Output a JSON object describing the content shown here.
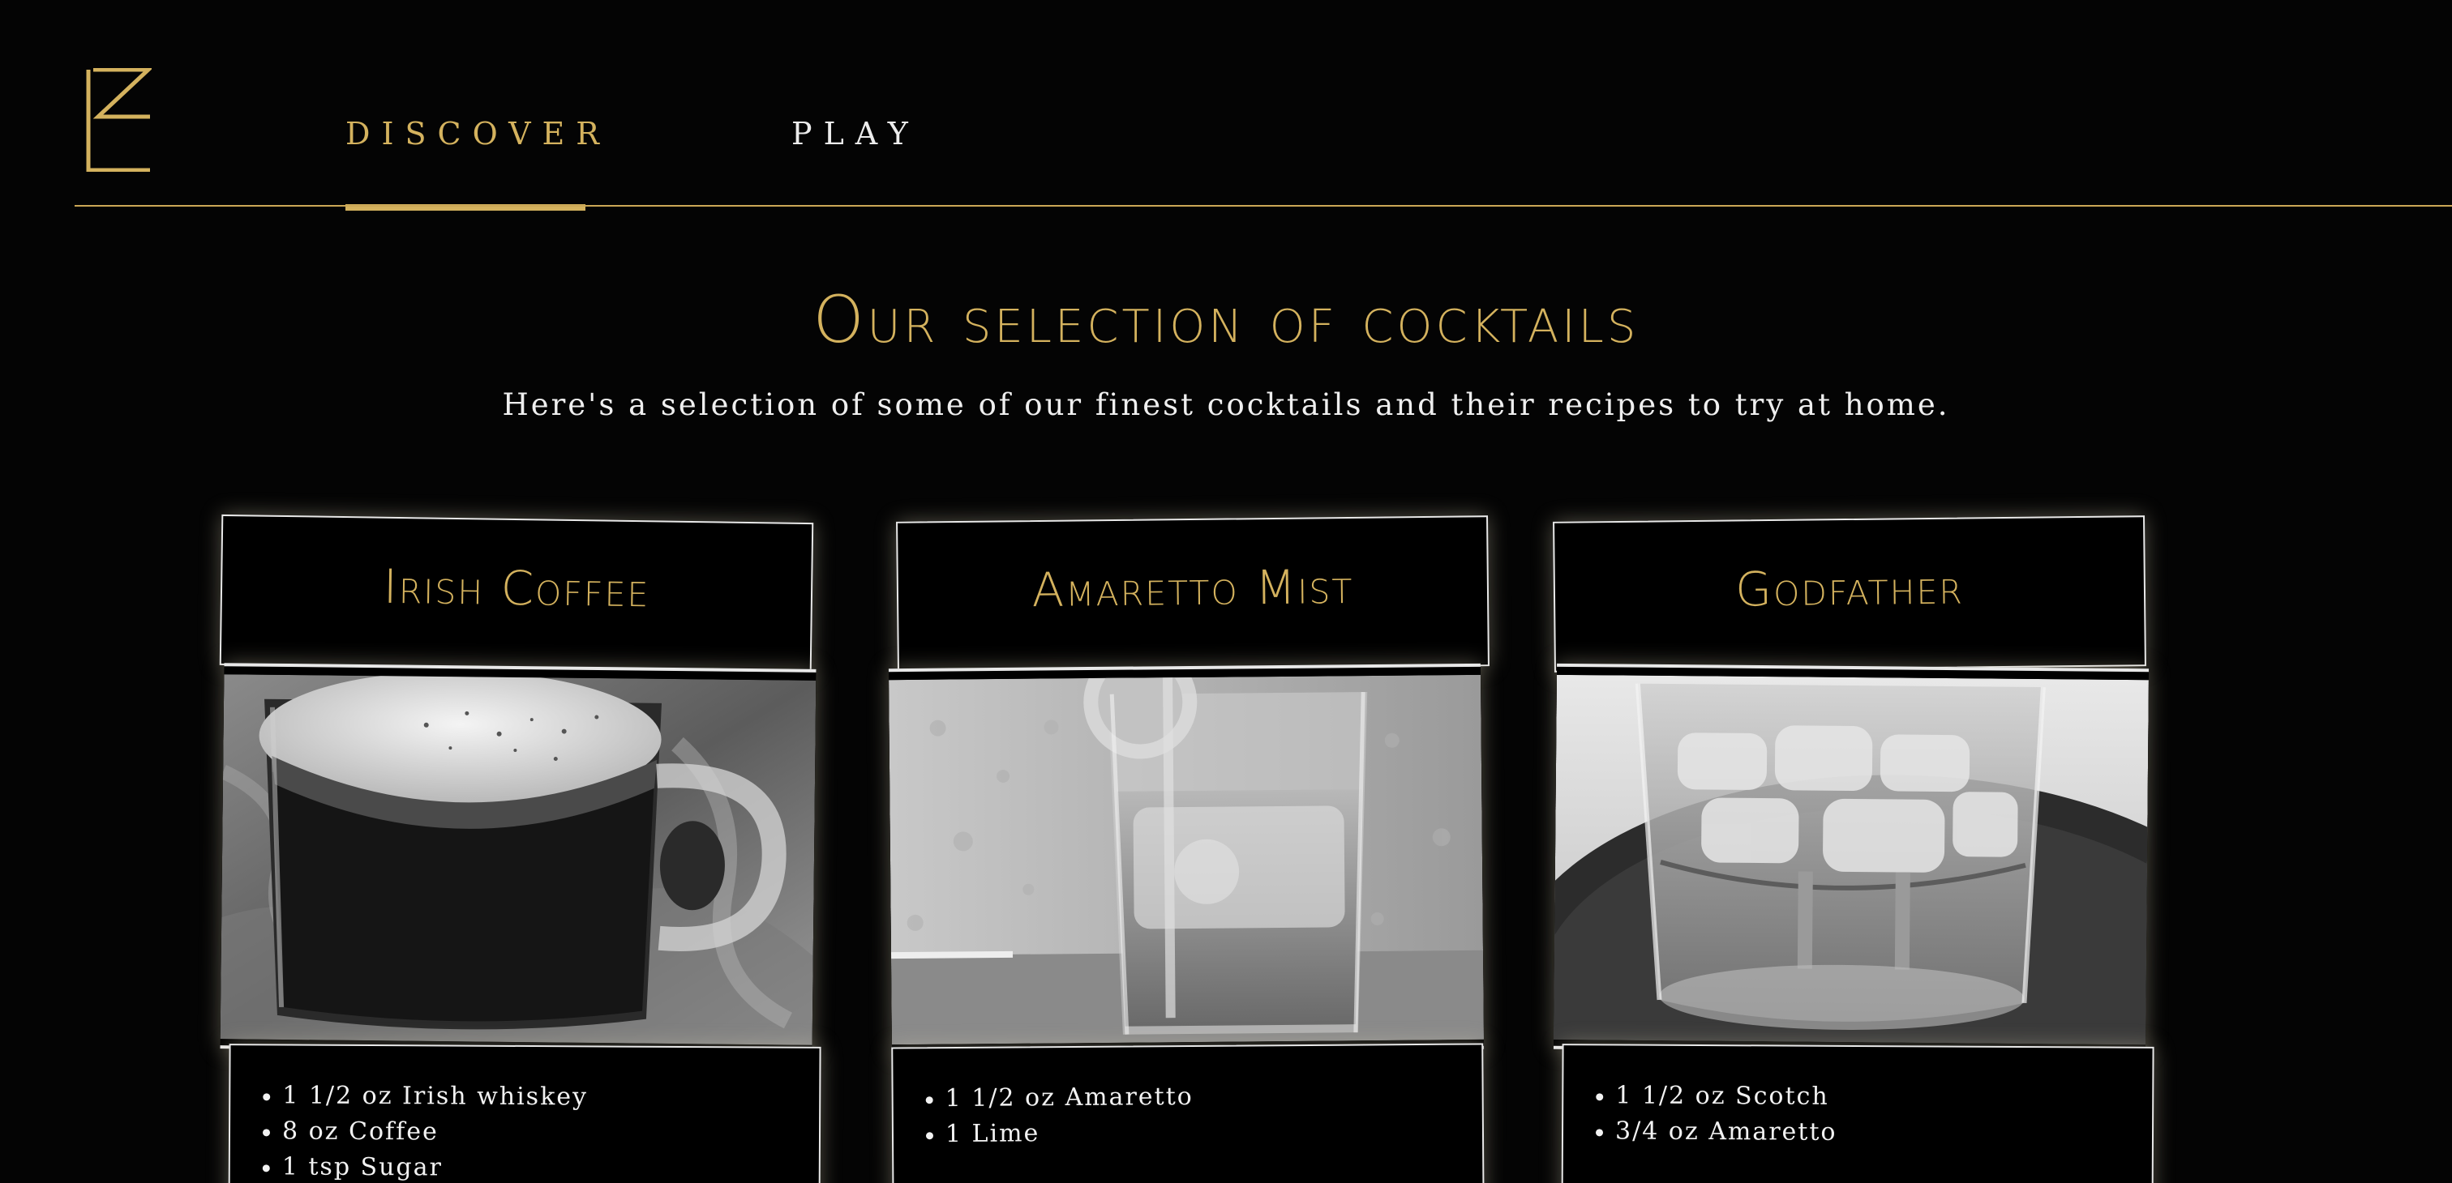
{
  "nav": {
    "logo_icon": "art-deco-E-logo-icon",
    "items": [
      {
        "label": "DISCOVER",
        "active": true
      },
      {
        "label": "PLAY",
        "active": false
      }
    ]
  },
  "heading": {
    "title": "Our selection of cocktails",
    "subtitle": "Here's a selection of some of our finest cocktails and their recipes to try at home."
  },
  "colors": {
    "accent": "#d4b25e",
    "background": "#040404",
    "card_border": "#e8e8e8",
    "text": "#f0f0f0"
  },
  "cards": [
    {
      "title": "Irish Coffee",
      "photo": "irish-coffee-mug-photo",
      "ingredients": [
        "1 1/2 oz Irish whiskey",
        "8 oz Coffee",
        "1 tsp Sugar"
      ]
    },
    {
      "title": "Amaretto Mist",
      "photo": "amaretto-mist-glass-photo",
      "ingredients": [
        "1 1/2 oz Amaretto",
        "1 Lime"
      ]
    },
    {
      "title": "Godfather",
      "photo": "godfather-glass-photo",
      "ingredients": [
        "1 1/2 oz Scotch",
        "3/4 oz Amaretto"
      ]
    }
  ]
}
